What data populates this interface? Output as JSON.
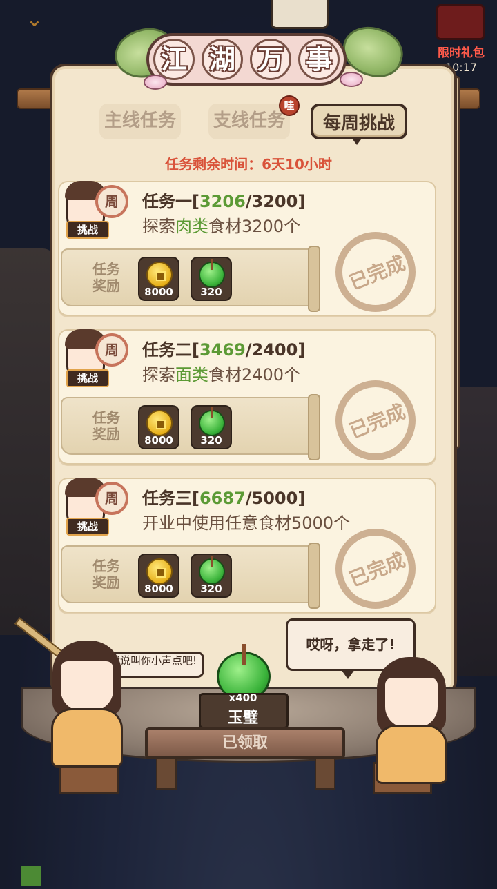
{
  "header": {
    "title_chars": [
      "江",
      "湖",
      "万",
      "事"
    ],
    "promo_label": "限时礼包",
    "promo_timer": "10:17"
  },
  "tabs": [
    {
      "label": "主线任务",
      "active": false
    },
    {
      "label": "支线任务",
      "active": false,
      "badge": "哇"
    },
    {
      "label": "每周挑战",
      "active": true
    }
  ],
  "remaining": {
    "label": "任务剩余时间：",
    "value": "6天10小时"
  },
  "tasks": [
    {
      "title": "任务一",
      "progress_current": "3206",
      "progress_total": "3200",
      "desc_prefix": "探索",
      "desc_highlight": "肉类",
      "desc_suffix": "食材3200个",
      "tag": "挑战",
      "coin_label": "周",
      "reward_label": "任务奖励",
      "rewards": [
        {
          "icon": "gold-coin-icon",
          "count": "8000"
        },
        {
          "icon": "jade-icon",
          "count": "320"
        }
      ],
      "status": "已完成"
    },
    {
      "title": "任务二",
      "progress_current": "3469",
      "progress_total": "2400",
      "desc_prefix": "探索",
      "desc_highlight": "面类",
      "desc_suffix": "食材2400个",
      "tag": "挑战",
      "coin_label": "周",
      "reward_label": "任务奖励",
      "rewards": [
        {
          "icon": "gold-coin-icon",
          "count": "8000"
        },
        {
          "icon": "jade-icon",
          "count": "320"
        }
      ],
      "status": "已完成"
    },
    {
      "title": "任务三",
      "progress_current": "6687",
      "progress_total": "5000",
      "desc_prefix": "开业中使用任意食材5000个",
      "desc_highlight": "",
      "desc_suffix": "",
      "tag": "挑战",
      "coin_label": "周",
      "reward_label": "任务奖励",
      "rewards": [
        {
          "icon": "gold-coin-icon",
          "count": "8000"
        },
        {
          "icon": "jade-icon",
          "count": "320"
        }
      ],
      "status": "已完成"
    }
  ],
  "bottom": {
    "bubble_left": "看，我说叫你小声点吧!",
    "bubble_right": "哎呀，拿走了!",
    "claim_count": "x400",
    "claim_item": "玉璧",
    "claim_button": "已领取"
  },
  "colors": {
    "accent_red": "#d9533a",
    "progress_green": "#5c9a35",
    "panel_bg": "#f3e6cd"
  }
}
